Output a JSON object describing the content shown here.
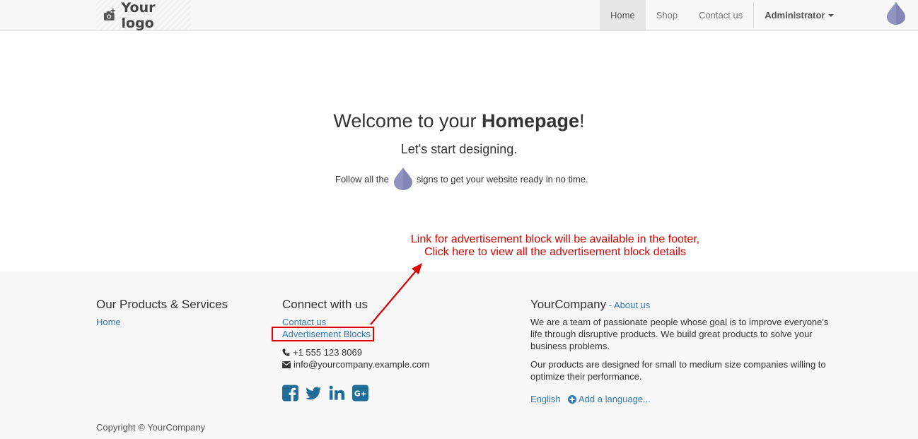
{
  "navbar": {
    "logo_text": "Your logo",
    "items": [
      {
        "label": "Home",
        "active": true
      },
      {
        "label": "Shop",
        "active": false
      },
      {
        "label": "Contact us",
        "active": false
      }
    ],
    "user_label": "Administrator"
  },
  "hero": {
    "title_pre": "Welcome to your ",
    "title_bold": "Homepage",
    "title_post": "!",
    "subtitle": "Let's start designing.",
    "follow_pre": "Follow all the",
    "follow_post": "signs to get your website ready in no time."
  },
  "annotation": {
    "line1": "Link for advertisement block will be available in the footer,",
    "line2": "Click here to view all the advertisement block details"
  },
  "footer": {
    "col1": {
      "title": "Our Products & Services",
      "links": [
        "Home"
      ]
    },
    "col2": {
      "title": "Connect with us",
      "links": [
        "Contact us",
        "Advertisement Blocks"
      ],
      "phone": "+1 555 123 8069",
      "email": "info@yourcompany.example.com",
      "social_icons": [
        "facebook-icon",
        "twitter-icon",
        "linkedin-icon",
        "google-plus-icon"
      ]
    },
    "col3": {
      "title": "YourCompany",
      "title_sep": " - ",
      "about_link": "About us",
      "para1_lines": [
        "We are a team of passionate people whose goal is to improve everyone's",
        "life through disruptive products. We build great products to solve your",
        "business problems."
      ],
      "para2_lines": [
        "Our products are designed for small to medium size companies willing to",
        "optimize their performance."
      ],
      "lang_current": "English",
      "lang_add": "Add a language..."
    },
    "copyright": "Copyright © YourCompany"
  },
  "colors": {
    "link": "#337ab7",
    "annotation": "#e00000",
    "drop": "#8385b5",
    "social": "#1f6d98"
  }
}
